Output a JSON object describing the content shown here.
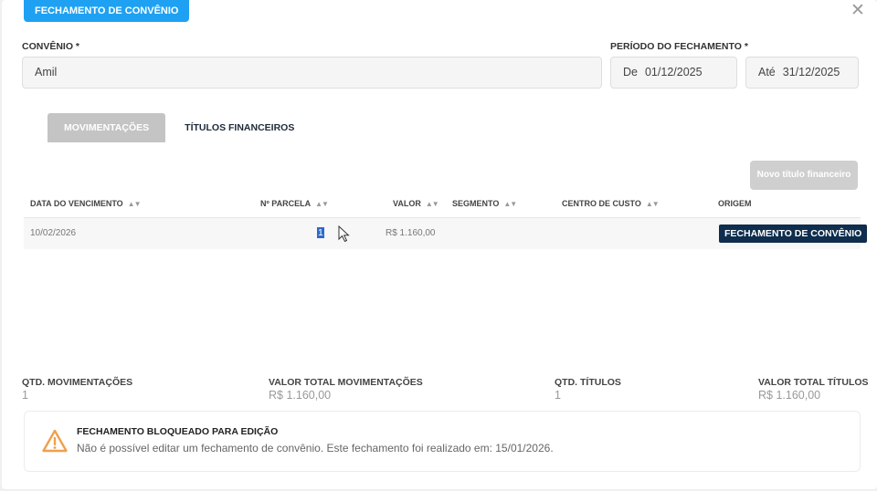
{
  "header": {
    "badge": "FECHAMENTO DE CONVÊNIO",
    "close_icon": "close-icon",
    "close_glyph": "✕"
  },
  "form": {
    "convenio_label": "CONVÊNIO *",
    "convenio_value": "Amil",
    "periodo_label": "PERÍODO DO FECHAMENTO *",
    "from_prefix": "De",
    "from_value": "01/12/2025",
    "to_prefix": "Até",
    "to_value": "31/12/2025"
  },
  "tabs": [
    {
      "label": "MOVIMENTAÇÕES",
      "active": true
    },
    {
      "label": "TÍTULOS FINANCEIROS",
      "active": false
    }
  ],
  "actions": {
    "new_title_button": "Novo título financeiro"
  },
  "table": {
    "columns": [
      "DATA DO VENCIMENTO",
      "Nº PARCELA",
      "VALOR",
      "SEGMENTO",
      "CENTRO DE CUSTO",
      "ORIGEM"
    ],
    "sort_glyph": "▲▼",
    "rows": [
      {
        "vencimento": "10/02/2026",
        "parcela": "1",
        "valor": "R$ 1.160,00",
        "segmento": "",
        "centro_custo": "",
        "origem": "FECHAMENTO DE CONVÊNIO"
      }
    ]
  },
  "summary": {
    "qtd_mov_label": "QTD. MOVIMENTAÇÕES",
    "qtd_mov_value": "1",
    "valor_mov_label": "VALOR TOTAL MOVIMENTAÇÕES",
    "valor_mov_value": "R$ 1.160,00",
    "qtd_titulos_label": "QTD. TÍTULOS",
    "qtd_titulos_value": "1",
    "valor_titulos_label": "VALOR TOTAL TÍTULOS",
    "valor_titulos_value": "R$ 1.160,00"
  },
  "alert": {
    "icon": "warning-icon",
    "title": "FECHAMENTO BLOQUEADO PARA EDIÇÃO",
    "message": "Não é possível editar um fechamento de convênio. Este fechamento foi realizado em: 15/01/2026."
  },
  "colors": {
    "accent": "#1ea1f2",
    "navy": "#0f2d4d",
    "warning": "#f0a04b"
  }
}
